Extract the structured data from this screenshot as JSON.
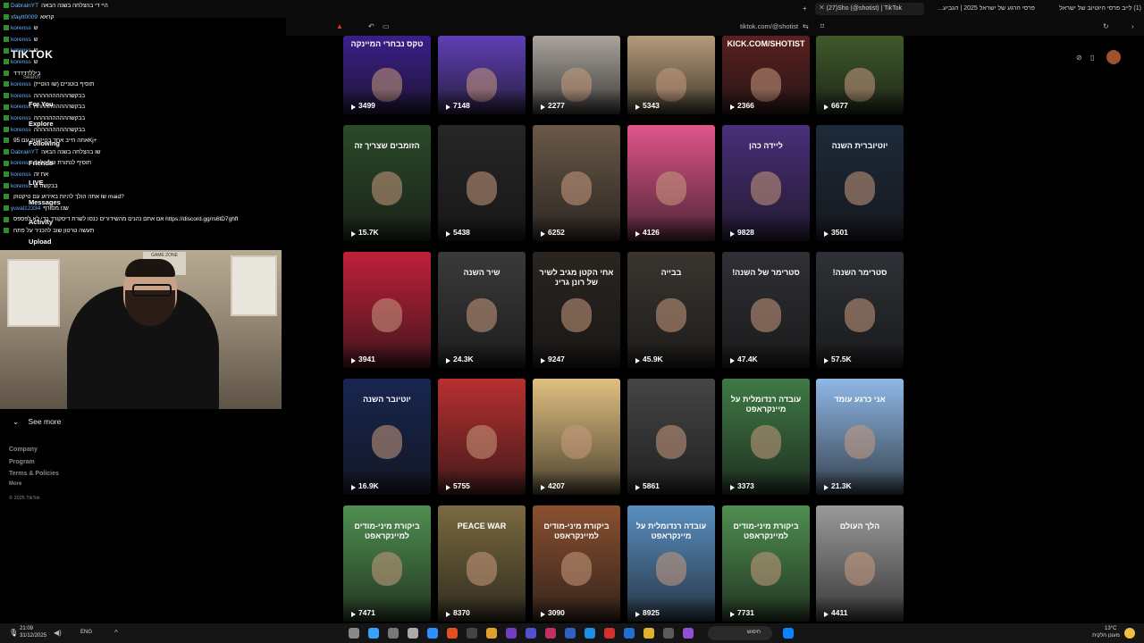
{
  "browser": {
    "tabs": [
      {
        "label": "(27)Sho (@shotist) | TikTok",
        "active": true
      },
      {
        "label": "פרסי הרגע של ישראל 2025 | הגביע...",
        "active": false
      },
      {
        "label": "(1) לייב פרסי היוטיוב של ישראל",
        "active": false
      }
    ],
    "url": "tiktok.com/@shotist"
  },
  "chat": [
    {
      "user": "DabrainYT",
      "msg": "היי די בהצלחה בשנה הבאה"
    },
    {
      "user": "xfaytt0009",
      "msg": "קראא"
    },
    {
      "user": "korenss",
      "msg": "ש"
    },
    {
      "user": "korenss",
      "msg": "ש"
    },
    {
      "user": "korenss",
      "msg": "ש"
    },
    {
      "user": "korenss",
      "msg": "ש"
    },
    {
      "user": "",
      "msg": "ביללדדדדד"
    },
    {
      "user": "korenss",
      "msg": "תוסיף בוטניים (שו הוטייז)"
    },
    {
      "user": "korenss",
      "msg": "בבקשהההההההההה"
    },
    {
      "user": "korenss",
      "msg": "בבקשהההההההההה"
    },
    {
      "user": "korenss",
      "msg": "בבקשהההההההההה"
    },
    {
      "user": "korenss",
      "msg": "בבקשהההההההההה"
    },
    {
      "user": "",
      "msg": "אתה חייב אחד בטיקטוק עם 95Kj+"
    },
    {
      "user": "DabrainYT",
      "msg": "שו בהצלחה בשנה הבאה"
    },
    {
      "user": "korenss",
      "msg": "תוסיף לנתורת של הלייב"
    },
    {
      "user": "korenss",
      "msg": "את זה"
    },
    {
      "user": "korenss",
      "msg": "בבקשה ש"
    },
    {
      "user": "",
      "msg": "שו אתה הולך להיות באירוע עם טיקטוק maid?"
    },
    {
      "user": "yuval12334",
      "msg": "שנו מסורף"
    },
    {
      "user": "",
      "msg": "אם אתם נהנים מהשידורים כנסו לשרת דיסקורד כדי לא לפספס https://discord.gg/rs6tD7ghft"
    },
    {
      "user": "",
      "msg": "תעשה טרטון שוב להכניר על פתח"
    }
  ],
  "tiktok_nav": {
    "logo": "TIKTOK",
    "search": "Search",
    "items": [
      "For You",
      "Explore",
      "Following",
      "Friends",
      "LIVE",
      "Messages",
      "Activity",
      "Upload"
    ],
    "see_more": "See more",
    "footer": [
      "Company",
      "Program",
      "Terms & Policies",
      "More",
      "© 2025 TikTok"
    ]
  },
  "webcam_poster": "GAME ZONE",
  "videos": [
    {
      "views": "3499",
      "caption": "טקס נבחרי המיינקה",
      "bg": "#3b1f8a"
    },
    {
      "views": "7148",
      "caption": "",
      "bg": "#5f3fb5"
    },
    {
      "views": "2277",
      "caption": "",
      "bg": "#a9a39c"
    },
    {
      "views": "5343",
      "caption": "",
      "bg": "#b49a78"
    },
    {
      "views": "2366",
      "caption": "KICK.COM/SHOTIST",
      "bg": "#5a2020"
    },
    {
      "views": "6677",
      "caption": "",
      "bg": "#3e5a2b"
    },
    {
      "views": "15.7K",
      "caption": "הזומבים שצריך זה",
      "bg": "#2c4a2a"
    },
    {
      "views": "5438",
      "caption": "",
      "bg": "#262626"
    },
    {
      "views": "6252",
      "caption": "",
      "bg": "#6a5848"
    },
    {
      "views": "4126",
      "caption": "",
      "bg": "#e0558a"
    },
    {
      "views": "9828",
      "caption": "ליידה כהן",
      "bg": "#4a2f7a"
    },
    {
      "views": "3501",
      "caption": "יוטיוברית השנה",
      "bg": "#1e2a3a"
    },
    {
      "views": "3941",
      "caption": "",
      "bg": "#c0203a"
    },
    {
      "views": "24.3K",
      "caption": "שיר השנה",
      "bg": "#3a3a3a"
    },
    {
      "views": "9247",
      "caption": "אחי הקטן מגיב לשיר של רונן גרינ",
      "bg": "#2b2520"
    },
    {
      "views": "45.9K",
      "caption": "בבייה",
      "bg": "#3a3530"
    },
    {
      "views": "47.4K",
      "caption": "סטרימר של השנה!",
      "bg": "#2f3035"
    },
    {
      "views": "57.5K",
      "caption": "סטרימר השנה!",
      "bg": "#2e3136"
    },
    {
      "views": "16.9K",
      "caption": "יוטיובר השנה",
      "bg": "#182650"
    },
    {
      "views": "5755",
      "caption": "",
      "bg": "#b83030"
    },
    {
      "views": "4207",
      "caption": "",
      "bg": "#e0c080"
    },
    {
      "views": "5861",
      "caption": "",
      "bg": "#454545"
    },
    {
      "views": "3373",
      "caption": "עובדה רנדומלית על מיינקראפט",
      "bg": "#3f7a45"
    },
    {
      "views": "21.3K",
      "caption": "אני כרגע עומד",
      "bg": "#8fb8e6"
    },
    {
      "views": "7471",
      "caption": "ביקורת מיני-מודים למיינקראפט",
      "bg": "#4f8f50"
    },
    {
      "views": "8370",
      "caption": "PEACE WAR",
      "bg": "#7a6a40"
    },
    {
      "views": "3090",
      "caption": "ביקורת מיני-מודים למיינקראפט",
      "bg": "#8a5030"
    },
    {
      "views": "8925",
      "caption": "עובדה רנדומלית על מיינקראפט",
      "bg": "#5a8fc0"
    },
    {
      "views": "7731",
      "caption": "ביקורת מיני-מודים למיינקראפט",
      "bg": "#4f8f50"
    },
    {
      "views": "4411",
      "caption": "הלך העולם",
      "bg": "#9a9a9a"
    }
  ],
  "taskbar": {
    "time": "21:09",
    "date": "31/12/2025",
    "lang": "ENG",
    "search": "חיפוש",
    "weather_temp": "13°C",
    "weather_desc": "מעונן חלקית"
  }
}
